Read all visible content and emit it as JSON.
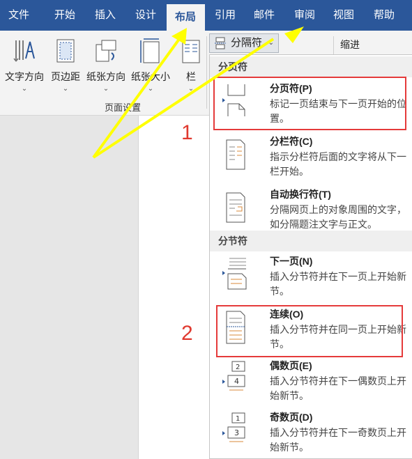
{
  "tabs": [
    "文件",
    "开始",
    "插入",
    "设计",
    "布局",
    "引用",
    "邮件",
    "审阅",
    "视图",
    "帮助"
  ],
  "active_tab": "布局",
  "ribbon": {
    "buttons": [
      "文字方向",
      "页边距",
      "纸张方向",
      "纸张大小",
      "栏"
    ],
    "group_label": "页面设置",
    "breaks_button": "分隔符",
    "indent_label": "缩进"
  },
  "dropdown": {
    "section_page": "分页符",
    "section_section": "分节符",
    "items": [
      {
        "title": "分页符(P)",
        "desc": "标记一页结束与下一页开始的位置。"
      },
      {
        "title": "分栏符(C)",
        "desc": "指示分栏符后面的文字将从下一栏开始。"
      },
      {
        "title": "自动换行符(T)",
        "desc": "分隔网页上的对象周围的文字，如分隔题注文字与正文。"
      },
      {
        "title": "下一页(N)",
        "desc": "插入分节符并在下一页上开始新节。"
      },
      {
        "title": "连续(O)",
        "desc": "插入分节符并在同一页上开始新节。"
      },
      {
        "title": "偶数页(E)",
        "desc": "插入分节符并在下一偶数页上开始新节。"
      },
      {
        "title": "奇数页(D)",
        "desc": "插入分节符并在下一奇数页上开始新节。"
      }
    ]
  },
  "annotations": {
    "num1": "1",
    "num2": "2"
  },
  "colors": {
    "title_bar": "#2b579a",
    "highlight_box": "#e53a3a",
    "arrow": "#ffff00"
  }
}
